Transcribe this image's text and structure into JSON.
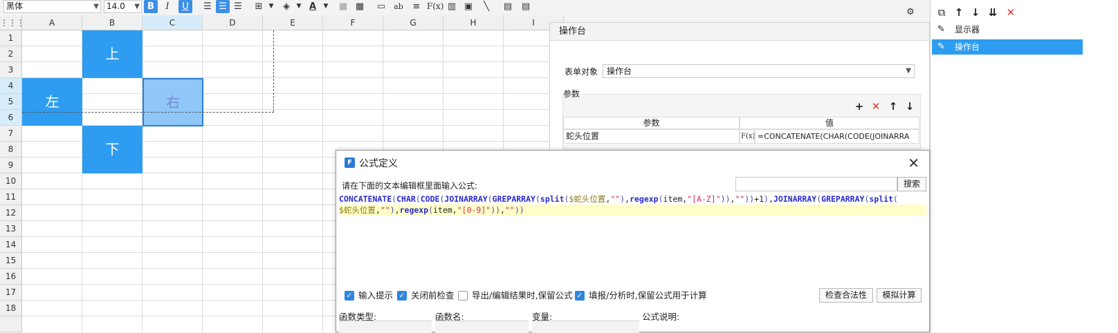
{
  "toolbar": {
    "font_name": "黑体",
    "font_size": "14.0",
    "bold_label": "B",
    "italic_label": "I",
    "underline_label": "U",
    "text_tool_label": "ab",
    "formula_label": "F(x)"
  },
  "sheet": {
    "columns": [
      "A",
      "B",
      "C",
      "D",
      "E",
      "F",
      "G",
      "H",
      "I"
    ],
    "rows": [
      "1",
      "2",
      "3",
      "4",
      "5",
      "6",
      "7",
      "8",
      "9",
      "10",
      "11",
      "12",
      "13",
      "14",
      "15",
      "16",
      "17",
      "18"
    ],
    "cell_up": "上",
    "cell_left": "左",
    "cell_right": "右",
    "cell_down": "下",
    "blue_color": "#2e9cf0"
  },
  "console": {
    "title": "操作台",
    "form_object_label": "表单对象",
    "form_object_value": "操作台",
    "params_label": "参数",
    "table_headers": [
      "参数",
      "值"
    ],
    "param_name": "蛇头位置",
    "param_fx": "F(x)",
    "param_value": "=CONCATENATE(CHAR(CODE(JOINARRA"
  },
  "right_panel": {
    "items": [
      "显示器",
      "操作台"
    ],
    "selected": "操作台"
  },
  "dialog": {
    "title": "公式定义",
    "prompt": "请在下面的文本编辑框里面输入公式:",
    "search_button": "搜索",
    "formula_line1": "CONCATENATE(CHAR(CODE(JOINARRAY(GREPARRAY(split($蛇头位置,\"\"),regexp(item,\"[A-Z]\")),\"\"))+1),JOINARRAY(GREPARRAY(split(",
    "formula_line2": "$蛇头位置,\"\"),regexp(item,\"[0-9]\")),\"\"))",
    "options": [
      {
        "label": "输入提示",
        "checked": true
      },
      {
        "label": "关闭前检查",
        "checked": true
      },
      {
        "label": "导出/编辑结果时,保留公式",
        "checked": false
      },
      {
        "label": "填报/分析时,保留公式用于计算",
        "checked": true
      }
    ],
    "check_button": "检查合法性",
    "simulate_button": "模拟计算",
    "bottom_labels": [
      "函数类型:",
      "函数名:",
      "变量:",
      "公式说明:"
    ]
  }
}
